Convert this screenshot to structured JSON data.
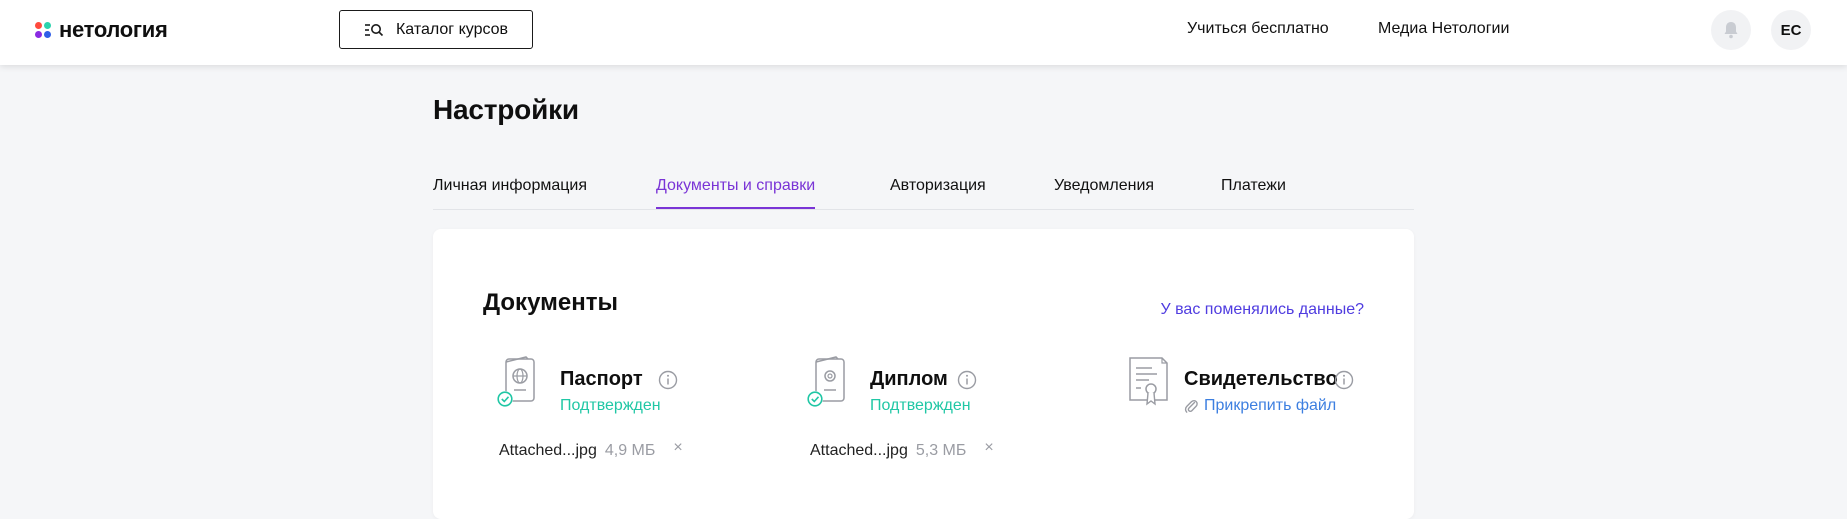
{
  "header": {
    "logo_text": "нетология",
    "catalog_label": "Каталог курсов",
    "nav": {
      "learn_free": "Учиться бесплатно",
      "media": "Медиа Нетологии"
    },
    "avatar_initials": "ЕС"
  },
  "page": {
    "title": "Настройки",
    "tabs": [
      {
        "label": "Личная информация"
      },
      {
        "label": "Документы и справки"
      },
      {
        "label": "Авторизация"
      },
      {
        "label": "Уведомления"
      },
      {
        "label": "Платежи"
      }
    ],
    "active_tab": "Документы и справки"
  },
  "documents": {
    "title": "Документы",
    "change_link": "У вас поменялись данные?",
    "items": [
      {
        "name": "Паспорт",
        "status": "Подтвержден",
        "file_name": "Attached...jpg",
        "file_size": "4,9 МБ"
      },
      {
        "name": "Диплом",
        "status": "Подтвержден",
        "file_name": "Attached...jpg",
        "file_size": "5,3 МБ"
      },
      {
        "name": "Свидетельство",
        "action": "Прикрепить файл"
      }
    ],
    "remove_glyph": "×"
  },
  "colors": {
    "accent_purple": "#7a34d6",
    "link_indigo": "#4f3ce0",
    "link_blue": "#3d7fe0",
    "status_green": "#20c7a5",
    "muted_gray": "#9a9ca3",
    "page_bg": "#f5f6f8"
  },
  "icons": {
    "catalog": "catalog-search-icon",
    "bell": "bell-icon",
    "passport": "passport-icon",
    "diploma": "diploma-icon",
    "certificate": "certificate-icon",
    "info": "info-icon",
    "check": "check-circle-icon",
    "paperclip": "paperclip-icon",
    "remove": "close-icon"
  }
}
